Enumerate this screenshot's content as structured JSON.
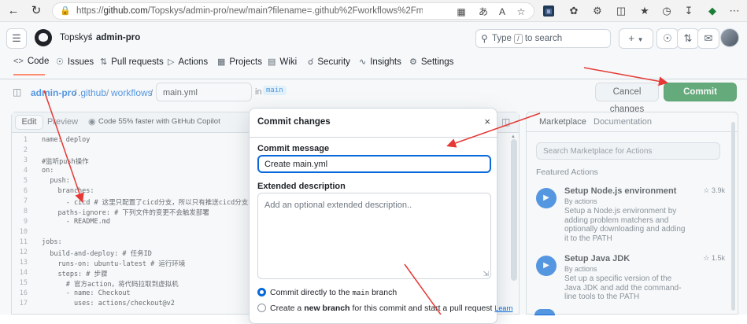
{
  "browser": {
    "url_prefix": "https://",
    "url_host": "github.com",
    "url_path": "/Topskys/admin-pro/new/main?filename=.github%2Fworkflows%2Fmain.yml&workflow_templ..."
  },
  "header": {
    "owner": "Topskys",
    "separator": "/",
    "repo": "admin-pro",
    "search_placeholder": "Type",
    "search_kbd": "/",
    "search_suffix": "to search",
    "new_label": "+"
  },
  "tabs": [
    {
      "label": "Code",
      "icon": "code-icon"
    },
    {
      "label": "Issues",
      "icon": "issue-icon"
    },
    {
      "label": "Pull requests",
      "icon": "pull-request-icon"
    },
    {
      "label": "Actions",
      "icon": "play-icon"
    },
    {
      "label": "Projects",
      "icon": "table-icon"
    },
    {
      "label": "Wiki",
      "icon": "book-icon"
    },
    {
      "label": "Security",
      "icon": "shield-icon"
    },
    {
      "label": "Insights",
      "icon": "graph-icon"
    },
    {
      "label": "Settings",
      "icon": "gear-icon"
    }
  ],
  "breadcrumb": {
    "repo": "admin-pro",
    "sep": "/",
    "folder1": ".github",
    "folder2": "workflows",
    "filename": "main.yml",
    "in_label": "in",
    "branch": "main"
  },
  "actions": {
    "cancel": "Cancel changes",
    "commit": "Commit changes..."
  },
  "editor": {
    "edit_tab": "Edit",
    "preview_tab": "Preview",
    "copilot": "Code 55% faster with GitHub Copilot",
    "lines": [
      {
        "n": "1",
        "t": "name: deploy"
      },
      {
        "n": "2",
        "t": ""
      },
      {
        "n": "3",
        "t": "#监听push操作"
      },
      {
        "n": "4",
        "t": "on:"
      },
      {
        "n": "5",
        "t": "  push:"
      },
      {
        "n": "6",
        "t": "    branches:"
      },
      {
        "n": "7",
        "t": "      - cicd # 这里只配置了cicd分支，所以只有推送cicd分支才会触发"
      },
      {
        "n": "8",
        "t": "    paths-ignore: # 下列文件的变更不会触发部署"
      },
      {
        "n": "9",
        "t": "      - README.md"
      },
      {
        "n": "10",
        "t": ""
      },
      {
        "n": "11",
        "t": "jobs:"
      },
      {
        "n": "12",
        "t": "  build-and-deploy: # 任务ID"
      },
      {
        "n": "13",
        "t": "    runs-on: ubuntu-latest # 运行环境"
      },
      {
        "n": "14",
        "t": "    steps: # 步骤"
      },
      {
        "n": "15",
        "t": "      # 官方action，将代码拉取到虚拟机"
      },
      {
        "n": "16",
        "t": "      - name: Checkout"
      },
      {
        "n": "17",
        "t": "        uses: actions/checkout@v2"
      }
    ]
  },
  "marketplace": {
    "tab1": "Marketplace",
    "tab2": "Documentation",
    "search_placeholder": "Search Marketplace for Actions",
    "section": "Featured Actions",
    "items": [
      {
        "name": "Setup Node.js environment",
        "by": "By actions",
        "desc": "Setup a Node.js environment by adding problem matchers and optionally downloading and adding it to the PATH",
        "stars": "3.9k"
      },
      {
        "name": "Setup Java JDK",
        "by": "By actions",
        "desc": "Set up a specific version of the Java JDK and add the command-line tools to the PATH",
        "stars": "1.5k"
      }
    ]
  },
  "modal": {
    "title": "Commit changes",
    "close": "×",
    "message_label": "Commit message",
    "message_value": "Create main.yml",
    "desc_label": "Extended description",
    "desc_placeholder": "Add an optional extended description..",
    "opt1_prefix": "Commit directly to the",
    "opt1_branch": "main",
    "opt1_suffix": "branch",
    "opt2_prefix": "Create a",
    "opt2_bold": "new branch",
    "opt2_suffix": "for this commit and start a pull request",
    "opt2_link": "Learn"
  }
}
